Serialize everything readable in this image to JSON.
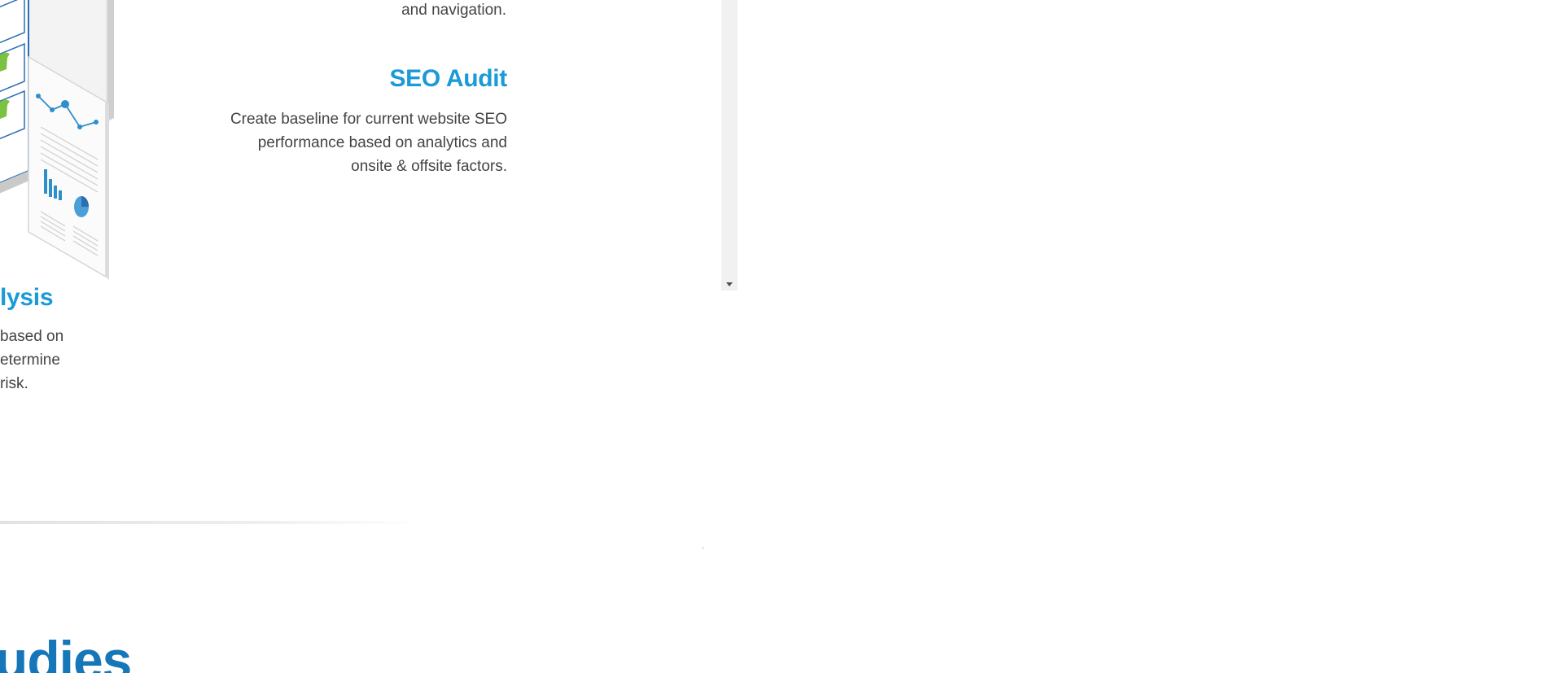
{
  "services": {
    "navigation_desc_tail": "and navigation.",
    "seo_audit": {
      "title": "SEO Audit",
      "lines": [
        "Create baseline for current website SEO",
        "performance based on analytics and",
        "onsite & offsite factors."
      ]
    },
    "analysis": {
      "title": "lysis",
      "lines": [
        "based on",
        "etermine",
        "risk."
      ]
    }
  },
  "section": {
    "heading": "udies"
  },
  "colors": {
    "accent": "#1a9ad6",
    "heading": "#1677b8",
    "body_text": "#444444",
    "scrollbar_track": "#f1f1f1"
  },
  "icons": {
    "illustration": "devices-report-illustration",
    "scroll_arrow": "chevron-down-icon"
  }
}
